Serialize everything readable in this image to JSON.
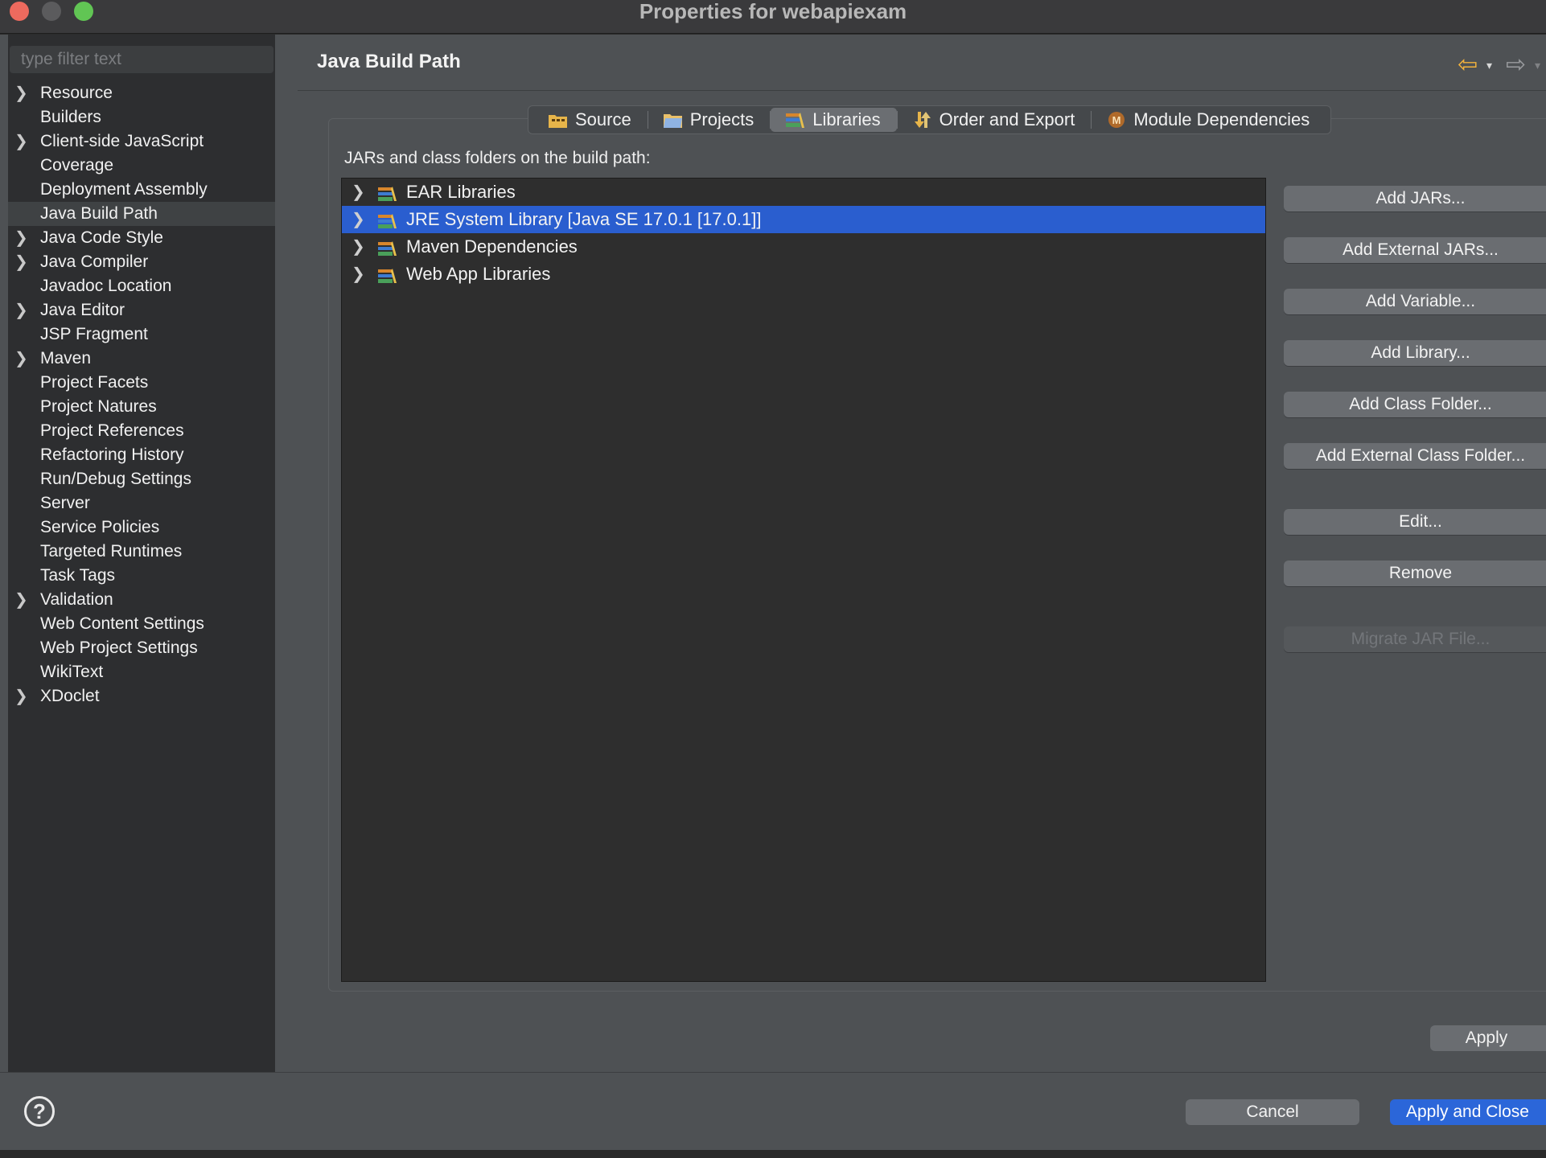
{
  "window": {
    "title": "Properties for webapiexam"
  },
  "sidebar": {
    "filter_placeholder": "type filter text",
    "items": [
      {
        "label": "Resource",
        "expandable": true
      },
      {
        "label": "Builders",
        "expandable": false
      },
      {
        "label": "Client-side JavaScript",
        "expandable": true
      },
      {
        "label": "Coverage",
        "expandable": false
      },
      {
        "label": "Deployment Assembly",
        "expandable": false
      },
      {
        "label": "Java Build Path",
        "expandable": false,
        "selected": true
      },
      {
        "label": "Java Code Style",
        "expandable": true
      },
      {
        "label": "Java Compiler",
        "expandable": true
      },
      {
        "label": "Javadoc Location",
        "expandable": false
      },
      {
        "label": "Java Editor",
        "expandable": true
      },
      {
        "label": "JSP Fragment",
        "expandable": false
      },
      {
        "label": "Maven",
        "expandable": true
      },
      {
        "label": "Project Facets",
        "expandable": false
      },
      {
        "label": "Project Natures",
        "expandable": false
      },
      {
        "label": "Project References",
        "expandable": false
      },
      {
        "label": "Refactoring History",
        "expandable": false
      },
      {
        "label": "Run/Debug Settings",
        "expandable": false
      },
      {
        "label": "Server",
        "expandable": false
      },
      {
        "label": "Service Policies",
        "expandable": false
      },
      {
        "label": "Targeted Runtimes",
        "expandable": false
      },
      {
        "label": "Task Tags",
        "expandable": false
      },
      {
        "label": "Validation",
        "expandable": true
      },
      {
        "label": "Web Content Settings",
        "expandable": false
      },
      {
        "label": "Web Project Settings",
        "expandable": false
      },
      {
        "label": "WikiText",
        "expandable": false
      },
      {
        "label": "XDoclet",
        "expandable": true
      }
    ]
  },
  "main": {
    "title": "Java Build Path",
    "tabs": [
      {
        "label": "Source",
        "icon": "source-folder-icon"
      },
      {
        "label": "Projects",
        "icon": "projects-folder-icon"
      },
      {
        "label": "Libraries",
        "icon": "libraries-icon",
        "active": true
      },
      {
        "label": "Order and Export",
        "icon": "order-export-icon"
      },
      {
        "label": "Module Dependencies",
        "icon": "module-icon"
      }
    ],
    "list_label": "JARs and class folders on the build path:",
    "libraries": [
      {
        "label": "EAR Libraries"
      },
      {
        "label": "JRE System Library [Java SE 17.0.1 [17.0.1]]",
        "selected": true
      },
      {
        "label": "Maven Dependencies"
      },
      {
        "label": "Web App Libraries"
      }
    ],
    "buttons": {
      "add_jars": "Add JARs...",
      "add_external_jars": "Add External JARs...",
      "add_variable": "Add Variable...",
      "add_library": "Add Library...",
      "add_class_folder": "Add Class Folder...",
      "add_external_class_folder": "Add External Class Folder...",
      "edit": "Edit...",
      "remove": "Remove",
      "migrate_jar": "Migrate JAR File..."
    },
    "apply": "Apply"
  },
  "footer": {
    "help": "?",
    "cancel": "Cancel",
    "apply_and_close": "Apply and Close"
  },
  "colors": {
    "selection": "#2a5ecf",
    "primary_button": "#2b66d9",
    "back_arrow": "#f3b23c"
  }
}
